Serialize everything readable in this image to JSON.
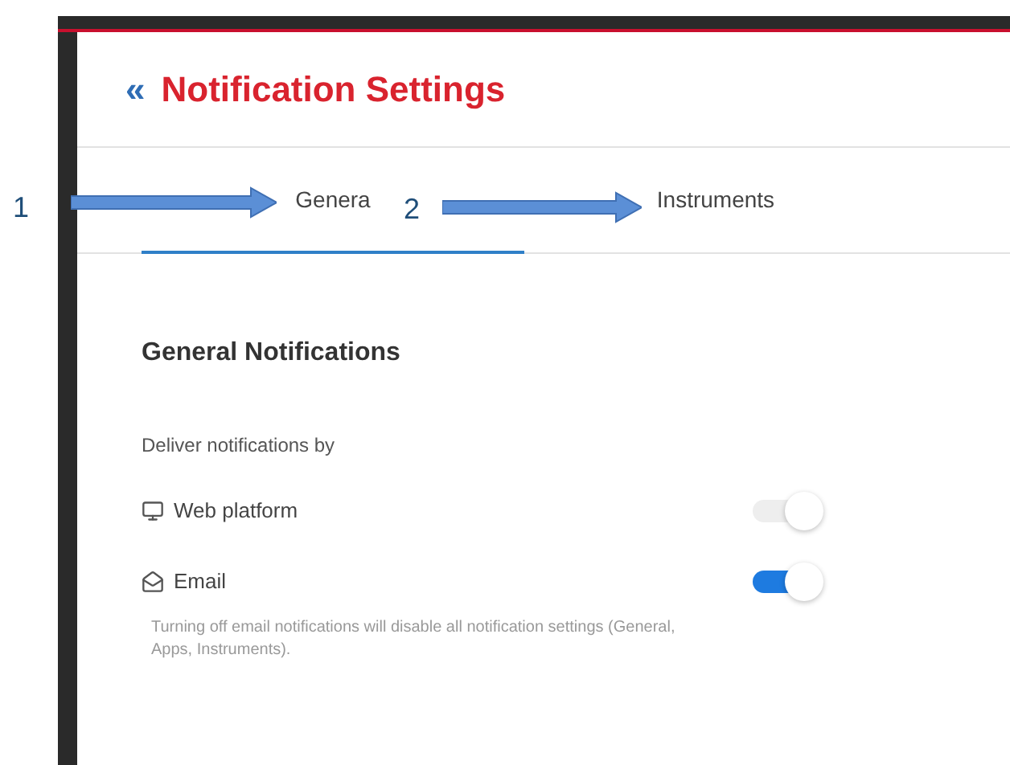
{
  "header": {
    "back": "«",
    "title": "Notification Settings"
  },
  "tabs": [
    {
      "label": "Genera",
      "selected": true
    },
    {
      "label": "Instruments",
      "selected": false
    }
  ],
  "section": {
    "heading": "General Notifications",
    "subheading": "Deliver notifications by"
  },
  "channels": [
    {
      "kind": "monitor",
      "label": "Web platform",
      "on": true,
      "disabled": true
    },
    {
      "kind": "email",
      "label": "Email",
      "on": true,
      "disabled": false
    }
  ],
  "note": "Turning off email notifications will disable all notification settings (General, Apps, Instruments).",
  "annotations": [
    {
      "label": "1"
    },
    {
      "label": "2"
    }
  ]
}
